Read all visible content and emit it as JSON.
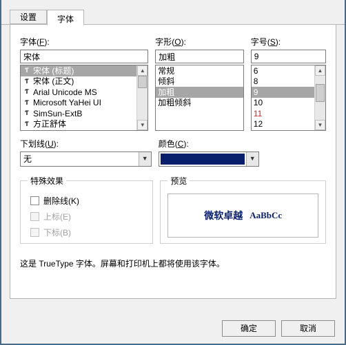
{
  "tabs": {
    "settings": "设置",
    "font": "字体"
  },
  "font": {
    "label_pre": "字体(",
    "label_ak": "F",
    "label_post": "):",
    "value": "宋体",
    "items": [
      {
        "text": "宋体 (标题)",
        "sel": true
      },
      {
        "text": "宋体 (正文)"
      },
      {
        "text": "Arial Unicode MS"
      },
      {
        "text": "Microsoft YaHei UI"
      },
      {
        "text": "SimSun-ExtB"
      },
      {
        "text": "方正舒体"
      }
    ]
  },
  "style": {
    "label_pre": "字形(",
    "label_ak": "O",
    "label_post": "):",
    "value": "加粗",
    "items": [
      {
        "text": "常规"
      },
      {
        "text": "倾斜"
      },
      {
        "text": "加粗",
        "sel": true
      },
      {
        "text": "加粗倾斜"
      }
    ]
  },
  "size": {
    "label_pre": "字号(",
    "label_ak": "S",
    "label_post": "):",
    "value": "9",
    "items": [
      {
        "text": "6"
      },
      {
        "text": "8"
      },
      {
        "text": "9",
        "sel": true
      },
      {
        "text": "10"
      },
      {
        "text": "11",
        "red": true
      },
      {
        "text": "12"
      }
    ]
  },
  "underline": {
    "label_pre": "下划线(",
    "label_ak": "U",
    "label_post": "):",
    "value": "无"
  },
  "color": {
    "label_pre": "颜色(",
    "label_ak": "C",
    "label_post": "):",
    "value_hex": "#0a1f6b"
  },
  "effects": {
    "legend": "特殊效果",
    "strike_pre": "删除线(",
    "strike_ak": "K",
    "strike_post": ")",
    "super": "上标(E)",
    "sub": "下标(B)"
  },
  "preview": {
    "legend": "预览",
    "cn": "微软卓越",
    "en": "AaBbCc"
  },
  "note": "这是 TrueType 字体。屏幕和打印机上都将使用该字体。",
  "buttons": {
    "ok": "确定",
    "cancel": "取消"
  },
  "glyphs": {
    "up": "▲",
    "down": "▼",
    "dd": "▼",
    "tt": "Ƭ"
  }
}
